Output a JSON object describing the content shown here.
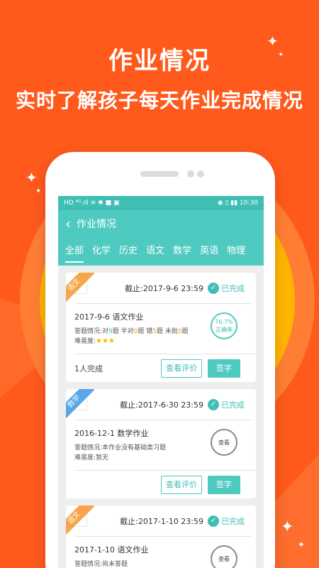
{
  "headline": {
    "title": "作业情况",
    "subtitle": "实时了解孩子每天作业完成情况"
  },
  "colors": {
    "background": "#ff5a1c",
    "accent": "#4fcac0",
    "yellow": "#f7b500"
  },
  "statusbar": {
    "left_icons": [
      "hd-icon",
      "signal-icon",
      "wifi-icon",
      "bluetooth-icon",
      "app-icon",
      "image-icon"
    ],
    "left_text": "HD ⁴ᴳ.ıll ≋ ✱ ■ ▣",
    "right_text": "◉ ▯ ▮▮ 10:30",
    "time": "10:30"
  },
  "appbar": {
    "title": "作业情况"
  },
  "tabs": [
    "全部",
    "化学",
    "历史",
    "语文",
    "数学",
    "英语",
    "物理"
  ],
  "cards": [
    {
      "subject": "语文",
      "ribbon_color": "#f7a54a",
      "deadline": "截止:2017-9-6 23:59",
      "status": "已完成",
      "title": "2017-9-6 语文作业",
      "stats": {
        "prefix": "答题情况:对",
        "right": "9",
        "half_label": "题  半对",
        "half": "0",
        "wrong_label": "题  错",
        "wrong": "5",
        "unmarked_label": "题  未批",
        "unmarked": "0",
        "suffix": "题"
      },
      "difficulty_label": "难易度:",
      "stars": "★★★",
      "circle_top": "76.7%",
      "circle_bottom": "正确率",
      "completed": "1人完成",
      "review_button": "查看评价",
      "sign_button": "签字"
    },
    {
      "subject": "数学",
      "ribbon_color": "#5aa6e8",
      "deadline": "截止:2017-6-30 23:59",
      "status": "已完成",
      "title": "2016-12-1 数学作业",
      "stats_text": "答题情况:本作业没有基础类习题",
      "difficulty_text": "难易度:暂无",
      "circle_text": "查看",
      "review_button": "查看评价",
      "sign_button": "签字"
    },
    {
      "subject": "语文",
      "ribbon_color": "#f7a54a",
      "deadline": "截止:2017-1-10 23:59",
      "status": "已完成",
      "title": "2017-1-10 语文作业",
      "stats_text": "答题情况:尚未答题",
      "circle_text": "查看"
    }
  ]
}
